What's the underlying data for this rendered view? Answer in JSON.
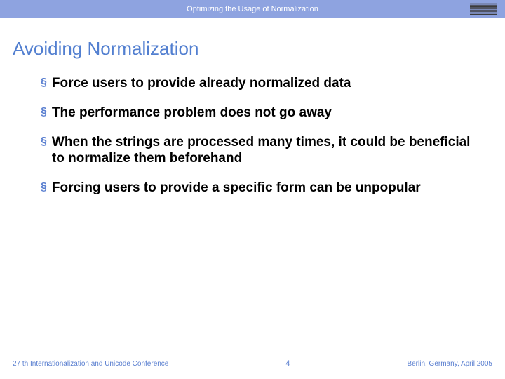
{
  "header": {
    "title": "Optimizing the Usage of Normalization",
    "logo": "IBM"
  },
  "slide": {
    "title": "Avoiding Normalization"
  },
  "bullets": [
    {
      "text": "Force users to provide already normalized data"
    },
    {
      "text": "The performance problem does not go away"
    },
    {
      "text": "When the strings are processed many times, it could be beneficial to normalize them beforehand"
    },
    {
      "text": "Forcing users to provide a specific form can be unpopular"
    }
  ],
  "footer": {
    "left": "27 th Internationalization and Unicode Conference",
    "center": "4",
    "right": "Berlin, Germany, April 2005"
  }
}
